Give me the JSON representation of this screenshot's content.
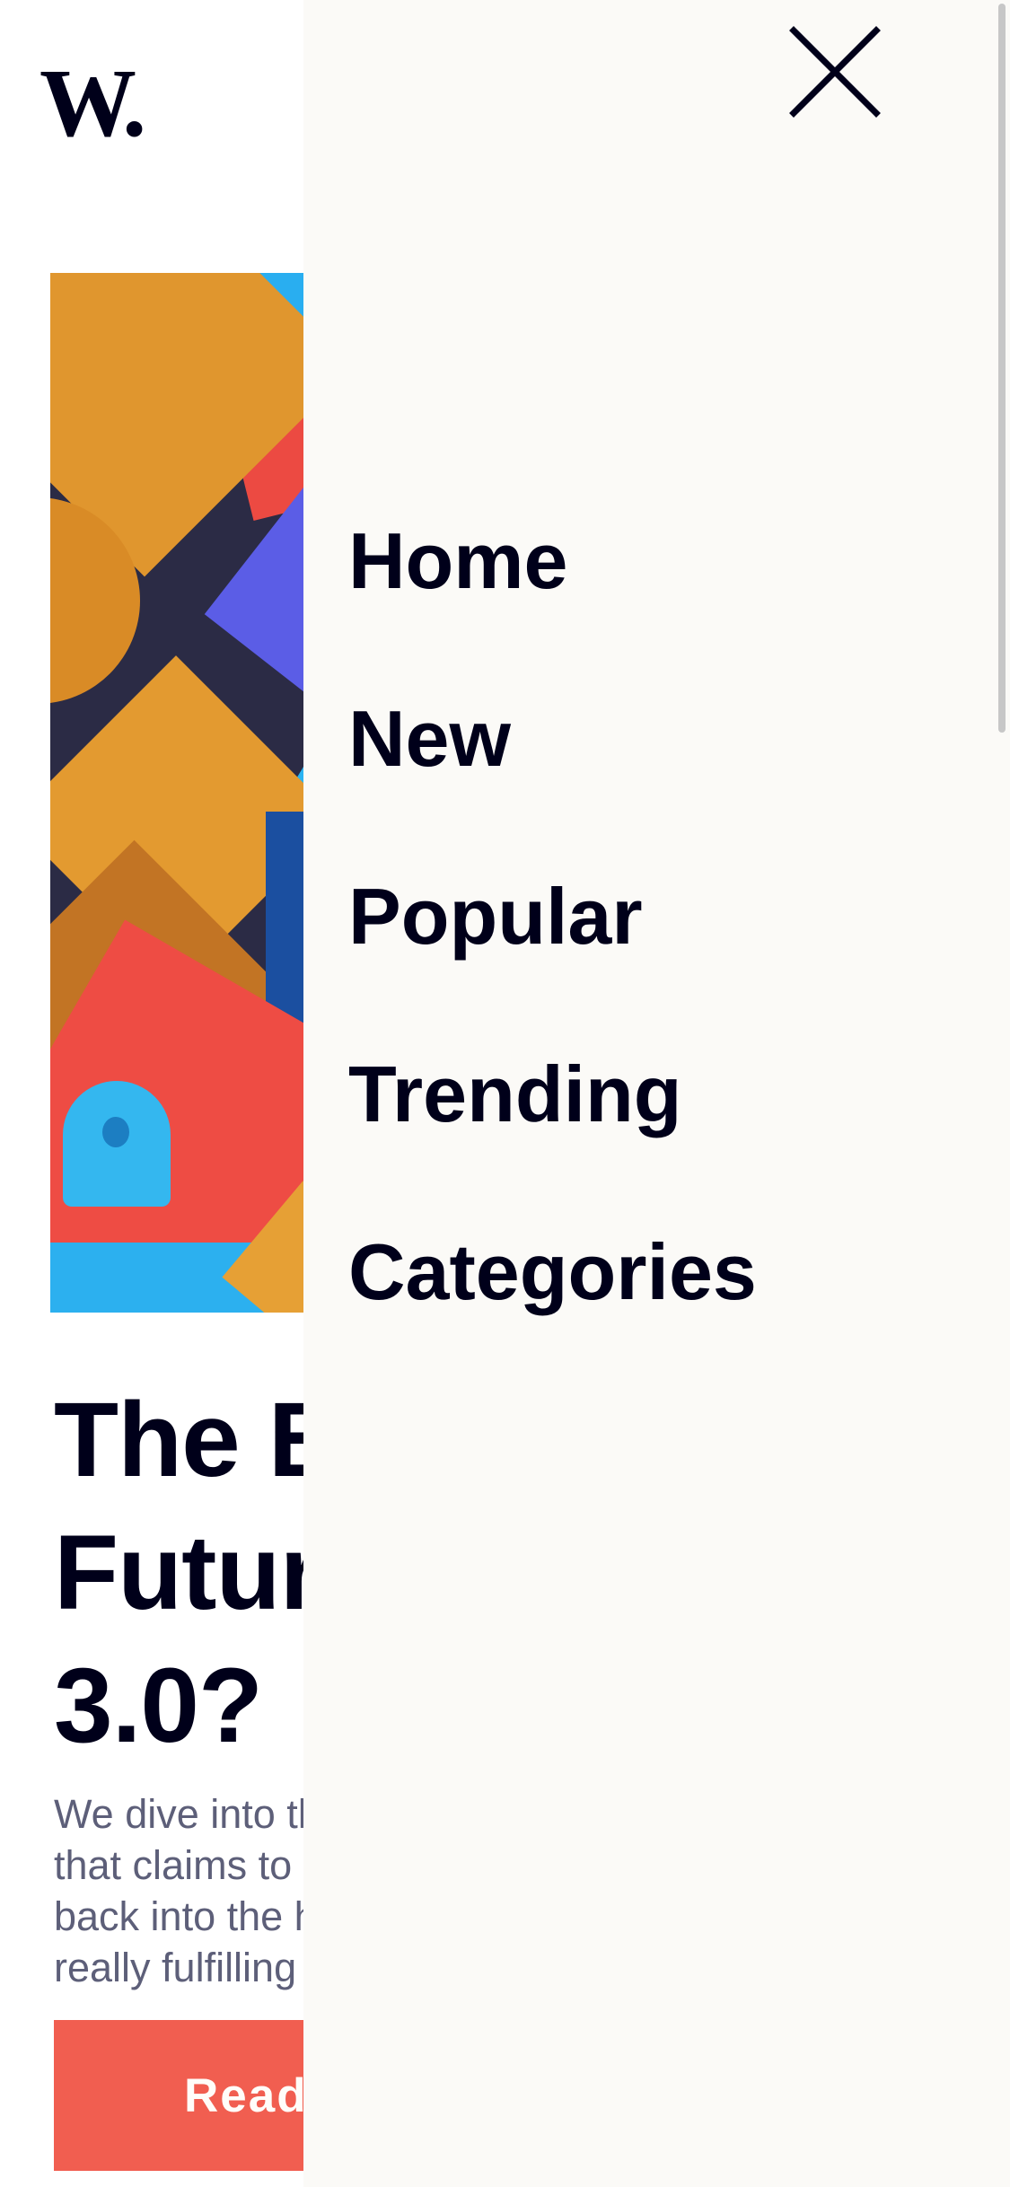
{
  "brand": {
    "logo_text": "W."
  },
  "article": {
    "headline_lines": [
      "The Bright",
      "Future of Web",
      "3.0?"
    ],
    "excerpt_lines": [
      "We dive into the next evolution of the web",
      "that claims to put the power of the platforms",
      "back into the hands of the people. But is it",
      "really fulfilling its promise?"
    ],
    "button_label": "Read more"
  },
  "menu": {
    "items": [
      {
        "label": "Home"
      },
      {
        "label": "New"
      },
      {
        "label": "Popular"
      },
      {
        "label": "Trending"
      },
      {
        "label": "Categories"
      }
    ],
    "close_icon": "close-icon"
  },
  "colors": {
    "text_dark": "#00001a",
    "accent": "#f15e50",
    "drawer_bg": "#fbfaf7",
    "muted_text": "#5d5f79"
  }
}
